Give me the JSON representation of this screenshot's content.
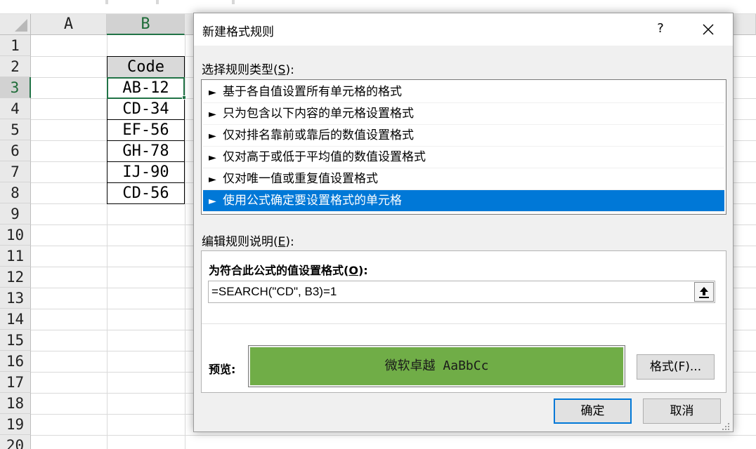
{
  "sheet": {
    "columns": [
      "A",
      "B"
    ],
    "rows": [
      "1",
      "2",
      "3",
      "4",
      "5",
      "6",
      "7",
      "8",
      "9",
      "10",
      "11",
      "12",
      "13",
      "14",
      "15",
      "16",
      "17",
      "18",
      "19",
      "20"
    ],
    "selected_column": "B",
    "selected_row": "3",
    "cells": {
      "b2": "Code",
      "b3": "AB-12",
      "b4": "CD-34",
      "b5": "EF-56",
      "b6": "GH-78",
      "b7": "IJ-90",
      "b8": "CD-56"
    },
    "accent_color": "#217346"
  },
  "dialog": {
    "title": "新建格式规则",
    "help_label": "?",
    "close_icon": "close-icon",
    "rule_type_label": "选择规则类型(",
    "rule_type_key": "S",
    "rule_type_suffix": "):",
    "rule_types": [
      "基于各自值设置所有单元格的格式",
      "只为包含以下内容的单元格设置格式",
      "仅对排名靠前或靠后的数值设置格式",
      "仅对高于或低于平均值的数值设置格式",
      "仅对唯一值或重复值设置格式",
      "使用公式确定要设置格式的单元格"
    ],
    "rule_arrow": "►",
    "selected_rule_index": 5,
    "selection_color": "#0078d7",
    "edit_label": "编辑规则说明(",
    "edit_key": "E",
    "edit_suffix": "):",
    "formula_label": "为符合此公式的值设置格式(",
    "formula_key": "O",
    "formula_suffix": "):",
    "formula_value": "=SEARCH(\"CD\", B3)=1",
    "preview_label": "预览:",
    "preview_text": "微软卓越  AaBbCc",
    "preview_fill": "#70ad47",
    "format_button": "格式(F)...",
    "ok_button": "确定",
    "cancel_button": "取消"
  }
}
